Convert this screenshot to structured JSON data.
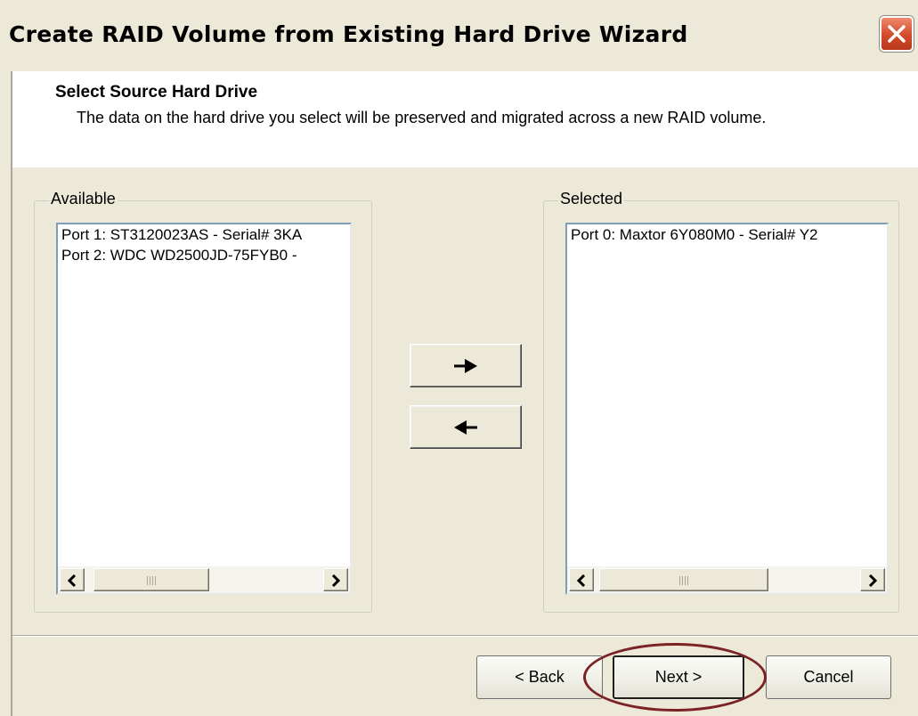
{
  "window": {
    "title": "Create RAID Volume from Existing Hard Drive Wizard"
  },
  "header": {
    "title": "Select Source Hard Drive",
    "description": "The data on the hard drive you select will be preserved and migrated across a new RAID volume."
  },
  "available": {
    "label": "Available",
    "items": [
      "Port 1: ST3120023AS - Serial# 3KA",
      "Port 2: WDC WD2500JD-75FYB0 -"
    ]
  },
  "selected": {
    "label": "Selected",
    "items": [
      "Port 0: Maxtor 6Y080M0 - Serial# Y2"
    ]
  },
  "buttons": {
    "back": "< Back",
    "next": "Next >",
    "cancel": "Cancel"
  },
  "icons": {
    "close": "close-icon",
    "move_right": "arrow-right-icon",
    "move_left": "arrow-left-icon",
    "scroll_left": "chevron-left-icon",
    "scroll_right": "chevron-right-icon"
  },
  "colors": {
    "dialog_bg": "#ece9d8",
    "header_bg": "#ffffff",
    "close_button": "#d24a2a",
    "annotation_ellipse": "#7a2226"
  }
}
